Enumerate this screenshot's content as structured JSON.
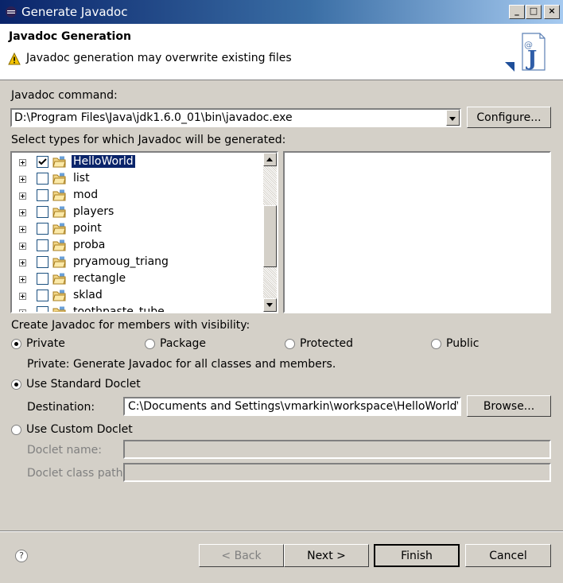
{
  "window": {
    "title": "Generate Javadoc"
  },
  "header": {
    "title": "Javadoc Generation",
    "message": "Javadoc generation may overwrite existing files"
  },
  "javadoc_command": {
    "label": "Javadoc command:",
    "value": "D:\\Program Files\\Java\\jdk1.6.0_01\\bin\\javadoc.exe",
    "configure_label": "Configure..."
  },
  "types": {
    "label": "Select types for which Javadoc will be generated:",
    "items": [
      {
        "label": "HelloWorld",
        "checked": true,
        "selected": true
      },
      {
        "label": "list",
        "checked": false
      },
      {
        "label": "mod",
        "checked": false
      },
      {
        "label": "players",
        "checked": false
      },
      {
        "label": "point",
        "checked": false
      },
      {
        "label": "proba",
        "checked": false
      },
      {
        "label": "pryamoug_triang",
        "checked": false
      },
      {
        "label": "rectangle",
        "checked": false
      },
      {
        "label": "sklad",
        "checked": false
      },
      {
        "label": "toothpaste_tube",
        "checked": false
      }
    ]
  },
  "visibility": {
    "label": "Create Javadoc for members with visibility:",
    "options": [
      {
        "label": "Private",
        "selected": true
      },
      {
        "label": "Package",
        "selected": false
      },
      {
        "label": "Protected",
        "selected": false
      },
      {
        "label": "Public",
        "selected": false
      }
    ],
    "description": "Private: Generate Javadoc for all classes and members."
  },
  "standard_doclet": {
    "label": "Use Standard Doclet",
    "selected": true,
    "destination_label": "Destination:",
    "destination_value": "C:\\Documents and Settings\\vmarkin\\workspace\\HelloWorld\\doc",
    "browse_label": "Browse..."
  },
  "custom_doclet": {
    "label": "Use Custom Doclet",
    "selected": false,
    "name_label": "Doclet name:",
    "classpath_label": "Doclet class path:"
  },
  "footer": {
    "help": "?",
    "back_label": "< Back",
    "next_label": "Next >",
    "finish_label": "Finish",
    "cancel_label": "Cancel"
  },
  "colors": {
    "titlebar": "#0a246a",
    "dialog_bg": "#d4d0c8",
    "selection": "#0a246a"
  }
}
